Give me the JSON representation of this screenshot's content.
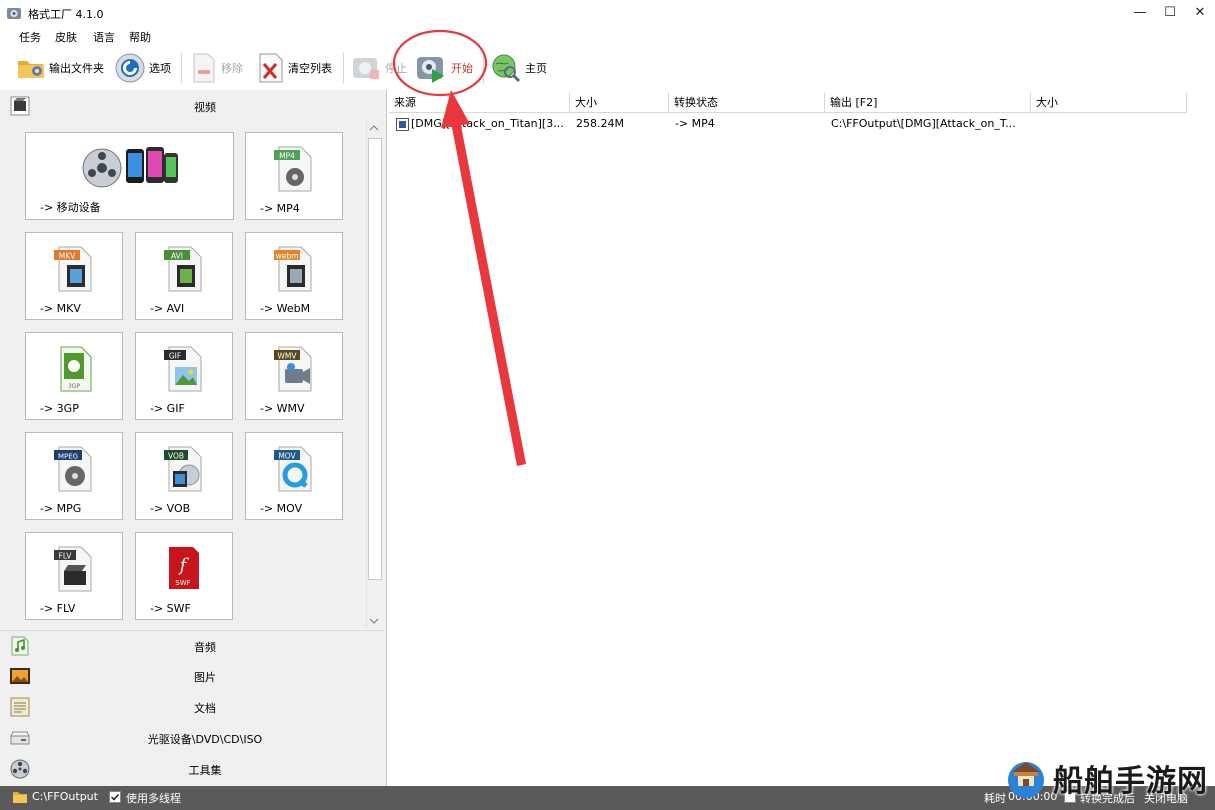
{
  "window": {
    "title": "格式工厂 4.1.0",
    "min_icon": "minimize-icon",
    "max_icon": "maximize-icon",
    "close_icon": "close-icon"
  },
  "menu": [
    "任务",
    "皮肤",
    "语言",
    "帮助"
  ],
  "toolbar": {
    "output_folder": "输出文件夹",
    "options": "选项",
    "remove": "移除",
    "clear_list": "清空列表",
    "stop": "停止",
    "start": "开始",
    "home": "主页"
  },
  "left": {
    "video_label": "视频",
    "tiles": [
      {
        "label": "-> 移动设备",
        "badge": ""
      },
      {
        "label": "-> MP4",
        "badge": "MP4"
      },
      {
        "label": "-> MKV",
        "badge": "MKV"
      },
      {
        "label": "-> AVI",
        "badge": "AVI"
      },
      {
        "label": "-> WebM",
        "badge": "webm"
      },
      {
        "label": "-> 3GP",
        "badge": "3GP"
      },
      {
        "label": "-> GIF",
        "badge": "GIF"
      },
      {
        "label": "-> WMV",
        "badge": "WMV"
      },
      {
        "label": "-> MPG",
        "badge": "MPEG"
      },
      {
        "label": "-> VOB",
        "badge": "VOB"
      },
      {
        "label": "-> MOV",
        "badge": "MOV"
      },
      {
        "label": "-> FLV",
        "badge": "FLV"
      },
      {
        "label": "-> SWF",
        "badge": "SWF"
      }
    ],
    "categories": [
      "音频",
      "图片",
      "文档",
      "光驱设备\\DVD\\CD\\ISO",
      "工具集"
    ]
  },
  "table": {
    "columns": [
      "来源",
      "大小",
      "转换状态",
      "输出 [F2]",
      "大小"
    ],
    "rows": [
      {
        "source": "[DMG][Attack_on_Titan][3...",
        "size": "258.24M",
        "status": "-> MP4",
        "output": "C:\\FFOutput\\[DMG][Attack_on_T...",
        "out_size": ""
      }
    ]
  },
  "status": {
    "output_path": "C:\\FFOutput",
    "multithread": "使用多线程",
    "elapsed_label": "耗时",
    "elapsed": "00:00:00",
    "after_label": "转换完成后",
    "after_action": "关闭电脑"
  },
  "watermark": {
    "text": "船舶手游网"
  },
  "colors": {
    "accent_red": "#e8383d",
    "status_bg": "#5a5a5a",
    "start_text": "#c0392b"
  }
}
